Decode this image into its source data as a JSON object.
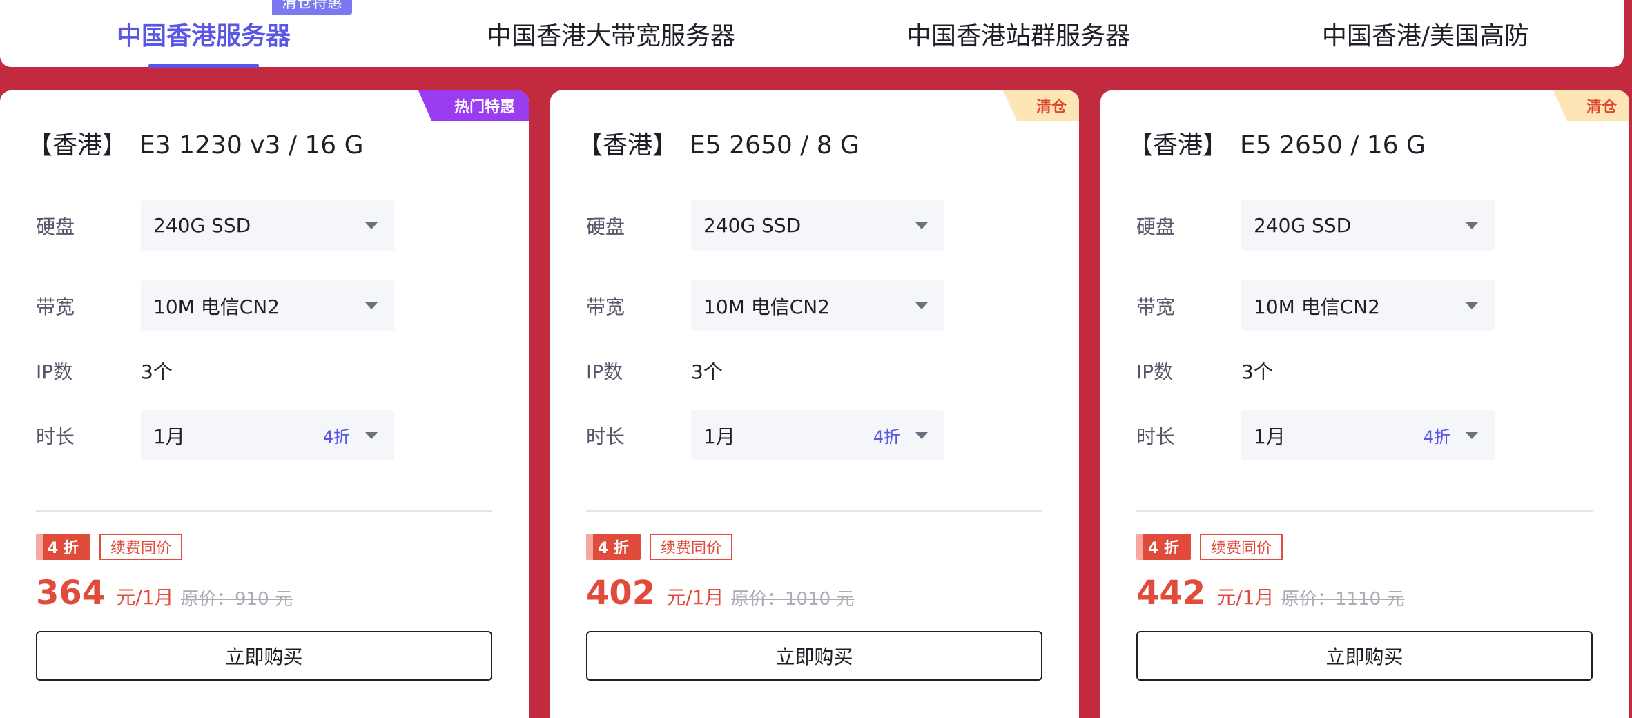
{
  "tabs": [
    {
      "label": "中国香港服务器",
      "active": true
    },
    {
      "label": "中国香港大带宽服务器",
      "active": false
    },
    {
      "label": "中国香港站群服务器",
      "active": false
    },
    {
      "label": "中国香港/美国高防",
      "active": false
    }
  ],
  "tab_badge": "清仓特惠",
  "labels": {
    "disk": "硬盘",
    "bandwidth": "带宽",
    "ip": "IP数",
    "duration": "时长"
  },
  "buy_label": "立即购买",
  "renew_label": "续费同价",
  "cards": [
    {
      "corner": "热门特惠",
      "region": "【香港】",
      "model": "E3 1230 v3 / 16 G",
      "disk": "240G SSD",
      "bandwidth": "10M 电信CN2",
      "ip": "3个",
      "duration": "1月",
      "duration_discount": "4折",
      "discount": "4 折",
      "price": "364",
      "price_unit": "元/1月",
      "original": "原价：910 元"
    },
    {
      "corner": "清仓",
      "region": "【香港】",
      "model": "E5 2650 / 8 G",
      "disk": "240G SSD",
      "bandwidth": "10M 电信CN2",
      "ip": "3个",
      "duration": "1月",
      "duration_discount": "4折",
      "discount": "4 折",
      "price": "402",
      "price_unit": "元/1月",
      "original": "原价：1010 元"
    },
    {
      "corner": "清仓",
      "region": "【香港】",
      "model": "E5 2650 / 16 G",
      "disk": "240G SSD",
      "bandwidth": "10M 电信CN2",
      "ip": "3个",
      "duration": "1月",
      "duration_discount": "4折",
      "discount": "4 折",
      "price": "442",
      "price_unit": "元/1月",
      "original": "原价：1110 元"
    }
  ],
  "colors": {
    "brand": "#5a57e6",
    "background": "#c12a3f",
    "price": "#e04b3c",
    "hot_corner": "#9a3cf0",
    "clear_corner": "#fde6b6"
  }
}
